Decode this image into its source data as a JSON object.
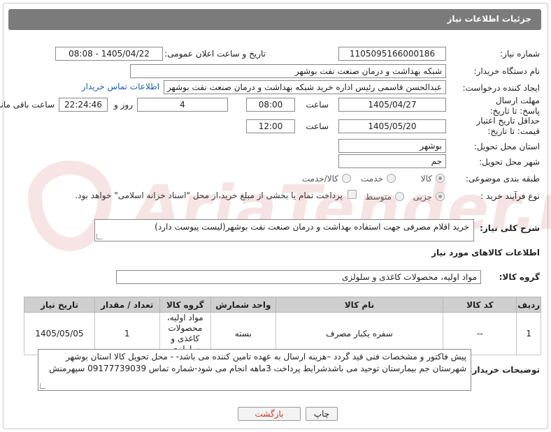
{
  "header": {
    "title": "جزئیات اطلاعات نیاز"
  },
  "fields": {
    "need_number_label": "شماره نیاز:",
    "need_number": "1105095166000186",
    "announce_label": "تاریخ و ساعت اعلان عمومی:",
    "announce_value": "1405/04/22 - 08:08",
    "buyer_org_label": "نام دستگاه خریدار:",
    "buyer_org": "شبکه بهداشت و درمان صنعت نفت بوشهر",
    "requester_label": "ایجاد کننده درخواست:",
    "requester": "عبدالحسن قاسمی رئیس اداره خرید  شبکه بهداشت و درمان صنعت نفت بوشهر",
    "contact_link": "اطلاعات تماس خریدار",
    "reply_deadline_label": "مهلت ارسال پاسخ: تا تاریخ:",
    "reply_date": "1405/04/27",
    "time_label": "ساعت",
    "reply_time": "08:00",
    "days_value": "4",
    "days_label": "روز و",
    "remaining_time": "22:24:46",
    "remaining_label": "ساعت باقی مانده",
    "price_validity_label": "حداقل تاریخ اعتبار قیمت: تا تاریخ:",
    "price_date": "1405/05/20",
    "price_time": "12:00",
    "province_label": "استان محل تحویل:",
    "province": "بوشهر",
    "city_label": "شهر محل تحویل:",
    "city": "جم",
    "category_label": "طبقه بندی موضوعی:",
    "category_options": [
      "کالا",
      "خدمت",
      "کالا/خدمت"
    ],
    "process_label": "نوع فرآیند خرید :",
    "process_options": [
      "جزیی",
      "متوسط"
    ],
    "payment_note": "پرداخت تمام یا بخشی از مبلغ خرید،از محل \"اسناد خزانه اسلامی\" خواهد بود."
  },
  "description": {
    "label": "شرح کلی نیاز:",
    "text": "خرید اقلام مصرفی جهت استفاده بهداشت و درمان صنعت نفت بوشهر(لیست پیوست دارد)"
  },
  "goods": {
    "section_title": "اطلاعات کالاهای مورد نیاز",
    "group_label": "گروه کالا:",
    "group_value": "مواد اولیه، محصولات کاغذی و سلولزی"
  },
  "table": {
    "headers": [
      "ردیف",
      "کد کالا",
      "نام کالا",
      "واحد شمارش",
      "گروه کالا",
      "تعداد / مقدار",
      "تاریخ نیاز"
    ],
    "rows": [
      [
        "1",
        "--",
        "سفره یکبار مصرف",
        "بسته",
        "مواد اولیه، محصولات کاغذی و سلولزی",
        "1",
        "1405/05/05"
      ]
    ]
  },
  "buyer_notes": {
    "label": "توضیحات خریدار:",
    "text": "پیش فاکتور و مشخصات فنی قید گردد –هزینه ارسال به عهده تامین کننده می باشد- - محل تحویل کالا استان بوشهر شهرستان جم بیمارستان توحید می باشدشرایط پرداخت 3ماهه انجام می شود-شماره تماس 09177739039 سپهرمنش"
  },
  "buttons": {
    "print": "چاپ",
    "back": "بازگشت"
  },
  "watermark": {
    "text": "AriaTender.net",
    "color": "#b00000"
  }
}
